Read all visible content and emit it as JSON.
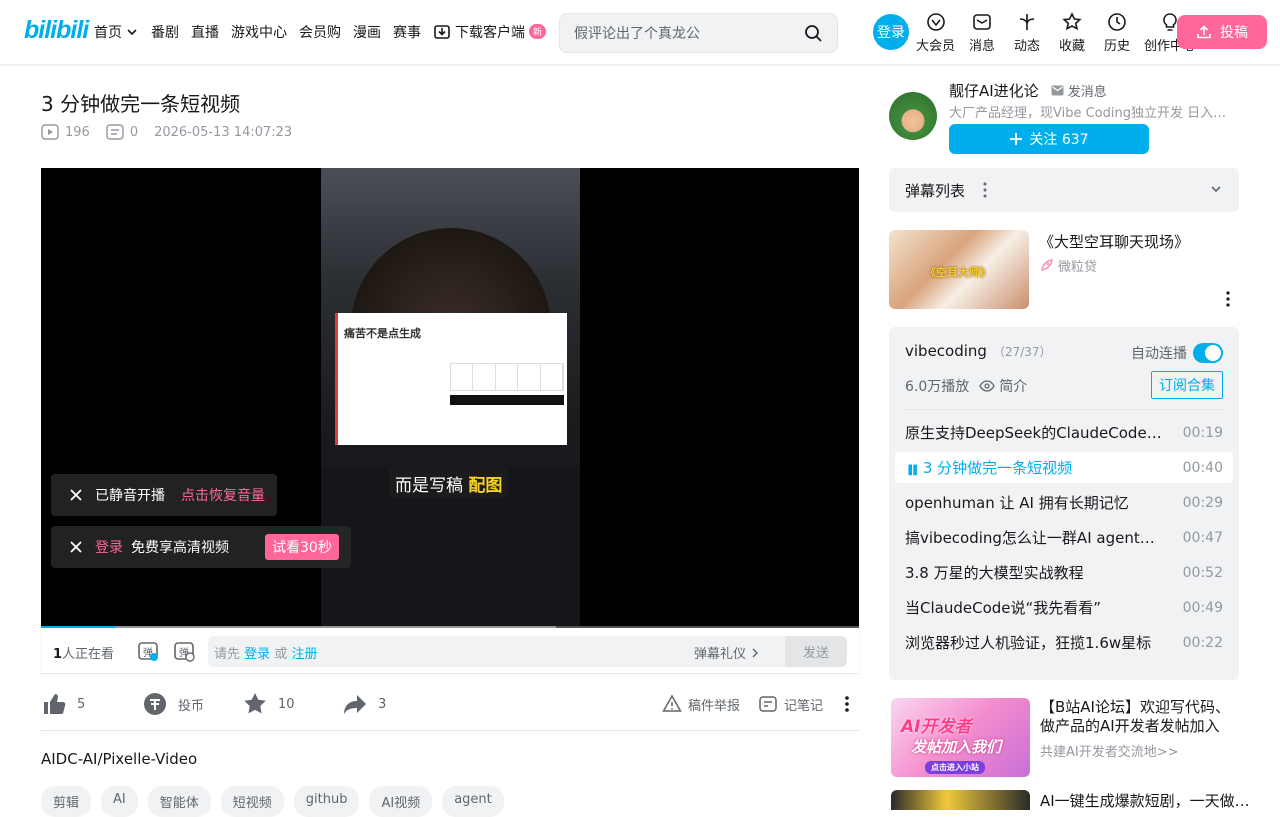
{
  "header": {
    "logo": "bilibili",
    "nav": [
      {
        "label": "首页",
        "dropdown": true
      },
      {
        "label": "番剧"
      },
      {
        "label": "直播"
      },
      {
        "label": "游戏中心"
      },
      {
        "label": "会员购"
      },
      {
        "label": "漫画"
      },
      {
        "label": "赛事"
      },
      {
        "label": "下载客户端",
        "badge": "新"
      }
    ],
    "search_placeholder": "假评论出了个真龙公",
    "login": "登录",
    "icons": [
      {
        "label": "大会员",
        "icon": "vip-icon"
      },
      {
        "label": "消息",
        "icon": "message-icon"
      },
      {
        "label": "动态",
        "icon": "dynamic-icon"
      },
      {
        "label": "收藏",
        "icon": "favorite-icon"
      },
      {
        "label": "历史",
        "icon": "history-icon"
      },
      {
        "label": "创作中心",
        "icon": "creator-icon"
      }
    ],
    "upload": "投稿"
  },
  "video": {
    "title": "3 分钟做完一条短视频",
    "views": "196",
    "danmaku_count": "0",
    "date": "2026-05-13 14:07:23",
    "subtitle_plain": "而是写稿",
    "subtitle_highlight": "配图",
    "slide_title": "痛苦不是点生成",
    "progress_fraction": 0.09,
    "buffered_fraction": 0.63,
    "toast_muted": "已静音开播",
    "toast_muted_action": "点击恢复音量",
    "toast_login": "登录",
    "toast_login_text": "免费享高清视频",
    "toast_try": "试看30秒"
  },
  "danmaku_bar": {
    "viewers_count": "1",
    "viewers_text": "人正在看",
    "hint_prefix": "请先",
    "login": "登录",
    "or": "或",
    "register": "注册",
    "etiquette": "弹幕礼仪",
    "send": "发送"
  },
  "actions": {
    "like": "5",
    "coin": "投币",
    "favorite": "10",
    "share": "3",
    "report": "稿件举报",
    "note": "记笔记"
  },
  "description": "AIDC-AI/Pixelle-Video",
  "tags": [
    "剪辑",
    "AI",
    "智能体",
    "短视频",
    "github",
    "AI视频",
    "agent"
  ],
  "uploader": {
    "name": "靓仔AI进化论",
    "message": "发消息",
    "bio": "大厂产品经理，现Vibe Coding独立开发 日入千…",
    "follow": "关注 637"
  },
  "danmaku_list": {
    "title": "弹幕列表"
  },
  "ad": {
    "title": "《大型空耳聊天现场》",
    "source": "微粒贷",
    "thumb_caption": "《空耳大师》"
  },
  "collection": {
    "name": "vibecoding",
    "count": "（27/37）",
    "autoplay": "自动连播",
    "plays": "6.0万播放",
    "intro": "简介",
    "subscribe": "订阅合集",
    "episodes": [
      {
        "title": "原生支持DeepSeek的ClaudeCode来了",
        "duration": "00:19"
      },
      {
        "title": "3 分钟做完一条短视频",
        "duration": "00:40",
        "active": true
      },
      {
        "title": "openhuman 让 AI 拥有长期记忆",
        "duration": "00:29"
      },
      {
        "title": "搞vibecoding怎么让一群AI agent真正…",
        "duration": "00:47"
      },
      {
        "title": "3.8 万星的大模型实战教程",
        "duration": "00:52"
      },
      {
        "title": "当ClaudeCode说“我先看看”",
        "duration": "00:49"
      },
      {
        "title": "浏览器秒过人机验证，狂揽1.6w星标",
        "duration": "00:22"
      },
      {
        "title": "…",
        "duration": ""
      }
    ]
  },
  "promo": {
    "title": "【B站AI论坛】欢迎写代码、做产品的AI开发者发帖加入",
    "subtitle": "共建AI开发者交流地>>",
    "thumb_l1": "AI开发者",
    "thumb_l2": "发帖加入我们",
    "thumb_l3": "点击进入小站"
  },
  "promo2": {
    "title": "AI一键生成爆款短剧，一天做…"
  },
  "colors": {
    "brand_blue": "#00aeec",
    "brand_pink": "#ff6699"
  }
}
